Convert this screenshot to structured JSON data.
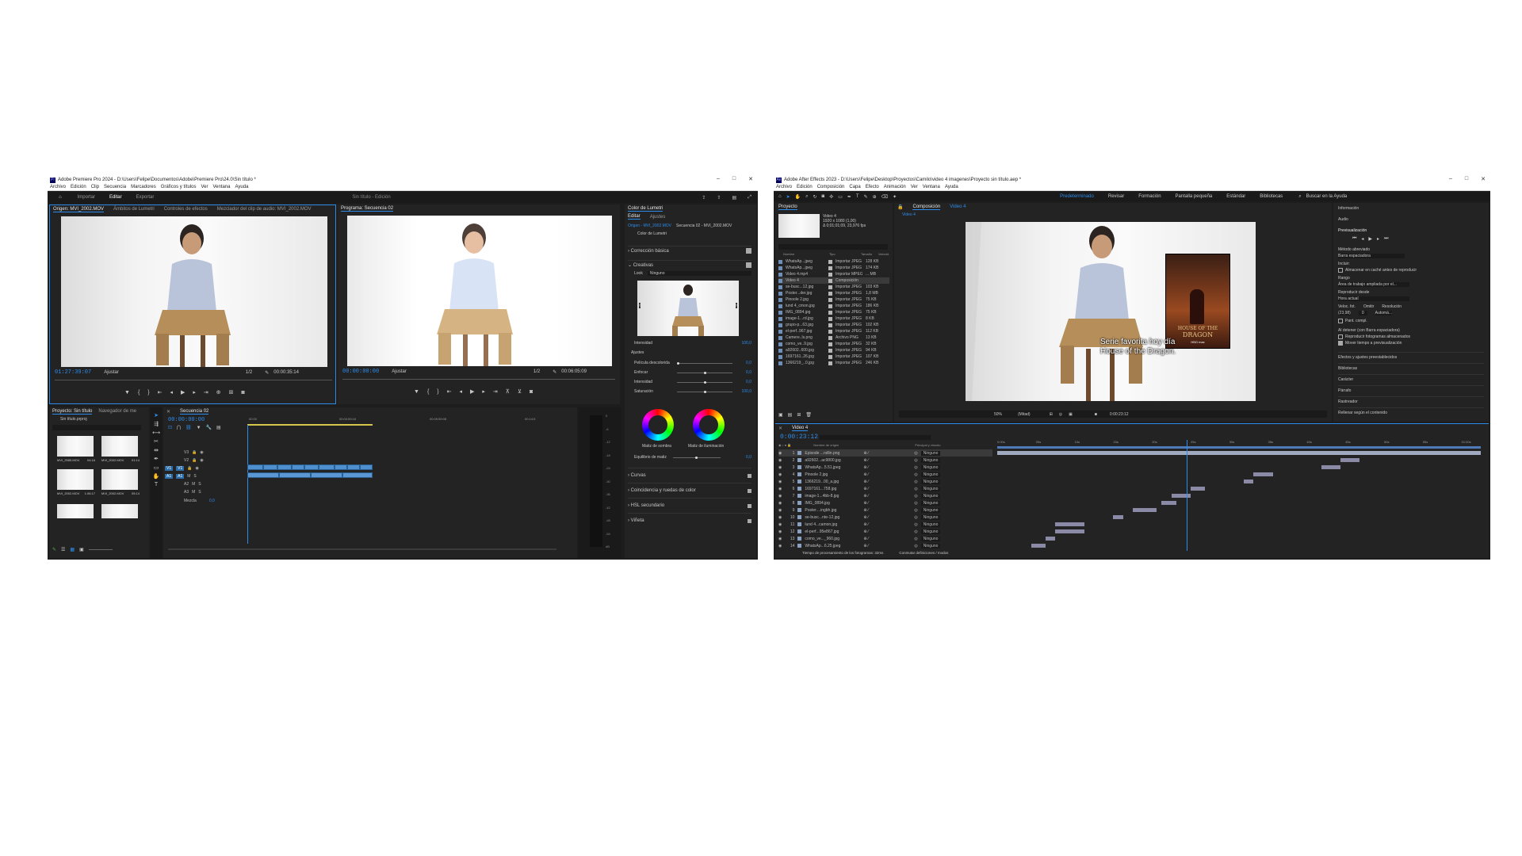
{
  "premiere": {
    "title": "Adobe Premiere Pro 2024 - D:\\Users\\Felipe\\Documentos\\Adobe\\Premiere Pro\\24.0\\Sin título *",
    "menu": [
      "Archivo",
      "Edición",
      "Clip",
      "Secuencia",
      "Marcadores",
      "Gráficos y títulos",
      "Ver",
      "Ventana",
      "Ayuda"
    ],
    "workspace_tabs": [
      "Importar",
      "Editar",
      "Exportar"
    ],
    "project_title": "Sin título - Edición",
    "source_tabs": [
      "Origen: MVI_2002.MOV",
      "Ámbitos de Lumetri",
      "Controles de efectos",
      "Mezclador del clip de audio: MVI_2002.MOV"
    ],
    "program_tab": "Programa: Secuencia 02",
    "source_tc": "01:27:39:07",
    "source_fit": "Ajustar",
    "source_ratio": "1/2",
    "source_duration": "00:00:35:14",
    "program_tc": "00:00:00:00",
    "program_fit": "Ajustar",
    "program_ratio": "1/2",
    "program_duration": "00:06:05:09",
    "lumetri": {
      "tab": "Color de Lumetri",
      "subtabs": [
        "Editar",
        "Ajustes"
      ],
      "source_clip": "Origen - MVI_2002.MOV",
      "seq_clip": "Secuencia 02 - MVI_2002.MOV",
      "effect": "Color de Lumetri",
      "sections": [
        "Corrección básica",
        "Creativas"
      ],
      "look_label": "Look",
      "look_value": "Ninguno",
      "intensity_label": "Intensidad",
      "intensity_value": "100,0",
      "adjust_label": "Ajustes",
      "sliders": [
        {
          "label": "Película descolorida",
          "value": "0,0"
        },
        {
          "label": "Enfocar",
          "value": "0,0"
        },
        {
          "label": "Intensidad",
          "value": "0,0"
        },
        {
          "label": "Saturación",
          "value": "100,0"
        }
      ],
      "wheel_labels": [
        "Matiz de sombra",
        "Matiz de iluminación"
      ],
      "balance_label": "Equilibrio de matiz",
      "balance_value": "0,0",
      "bottom_sections": [
        "Curvas",
        "Coincidencia y ruedas de color",
        "HSL secundario",
        "Viñeta"
      ]
    },
    "project_panel": {
      "tabs": [
        "Proyecto: Sin título",
        "Navegador de me"
      ],
      "file": "Sin título.prproj",
      "thumbs": [
        {
          "name": "MVI_2585.MOV",
          "dur": "04:16"
        },
        {
          "name": "MVI_2002.MOV",
          "dur": "01:14"
        },
        {
          "name": "MVI_2002.MOV",
          "dur": "1:06:17"
        },
        {
          "name": "MVI_2002.MOV",
          "dur": "05:14"
        }
      ]
    },
    "timeline": {
      "tab": "Secuencia 02",
      "tc": "00:00:00:00",
      "ruler": [
        "00:00",
        "00:04:59:16",
        "00:09:59:08",
        "00:14:5"
      ],
      "tracks": [
        "V3",
        "V2",
        "V1",
        "A1",
        "A2",
        "A3"
      ],
      "mix_label": "Mezcla",
      "mix_value": "0,0",
      "meter_labels": [
        "0",
        "-6",
        "-12",
        "-18",
        "-24",
        "-30",
        "-36",
        "-42",
        "-48",
        "-54",
        "dB"
      ]
    }
  },
  "aftereffects": {
    "title": "Adobe After Effects 2023 - D:\\Users\\Felipe\\Desktop\\Proyectos\\Camilo\\video 4 imagenes\\Proyecto sin título.aep *",
    "menu": [
      "Archivo",
      "Edición",
      "Composición",
      "Capa",
      "Efecto",
      "Animación",
      "Ver",
      "Ventana",
      "Ayuda"
    ],
    "workspaces": [
      "Predeterminado",
      "Revisar",
      "Formación",
      "Pantalla pequeña",
      "Estándar",
      "Bibliotecas"
    ],
    "search": "Buscar en la Ayuda",
    "project_tab": "Proyecto",
    "comp_info": {
      "name": "Video 4",
      "size": "1920 x 1080 (1,00)",
      "dur": "Δ 0;01;01;09, 23,976 fps"
    },
    "project_columns": [
      "Nombre",
      "Tipo",
      "Tamaño",
      "Velocid."
    ],
    "project_items": [
      {
        "name": "WhatsAp...jpeg",
        "type": "Importar JPEG",
        "size": "128 KB"
      },
      {
        "name": "WhatsAp...jpeg",
        "type": "Importar JPEG",
        "size": "174 KB"
      },
      {
        "name": "Video 4.mp4",
        "type": "Importar MPEG",
        "size": "... MB"
      },
      {
        "name": "Video 4",
        "type": "Composición",
        "size": ""
      },
      {
        "name": "se-busc...12.jpg",
        "type": "Importar JPEG",
        "size": "103 KB"
      },
      {
        "name": "Poster...der.jpg",
        "type": "Importar JPEG",
        "size": "1,8 MB"
      },
      {
        "name": "Pinoole 2.jpg",
        "type": "Importar JPEG",
        "size": "75 KB"
      },
      {
        "name": "lund 4_cmon.jpg",
        "type": "Importar JPEG",
        "size": "186 KB"
      },
      {
        "name": "IMG_0894.jpg",
        "type": "Importar JPEG",
        "size": "75 KB"
      },
      {
        "name": "image-1...rd.jpg",
        "type": "Importar JPEG",
        "size": "8 KB"
      },
      {
        "name": "grupo-p...63.jpg",
        "type": "Importar JPEG",
        "size": "102 KB"
      },
      {
        "name": "el-perf..967.jpg",
        "type": "Importar JPEG",
        "size": "112 KB"
      },
      {
        "name": "Camere..ls.png",
        "type": "Archivo PNG",
        "size": "13 KB"
      },
      {
        "name": "como_ve..9.jpg",
        "type": "Importar JPEG",
        "size": "32 KB"
      },
      {
        "name": "a92602..600.jpg",
        "type": "Importar JPEG",
        "size": "94 KB"
      },
      {
        "name": "1697161..26.jpg",
        "type": "Importar JPEG",
        "size": "107 KB"
      },
      {
        "name": "1366219_..0.jpg",
        "type": "Importar JPEG",
        "size": "246 KB"
      }
    ],
    "comp_tab": "Composición",
    "comp_name": "Video 4",
    "subtitle_line1": "Serie favorita hoy día",
    "subtitle_line2": "House of the Dragon.",
    "poster_title": "HOUSE OF THE",
    "poster_title2": "DRAGON",
    "poster_brand": "HBO max",
    "viewer_zoom": "50%",
    "viewer_res": "(Mitad)",
    "viewer_tc": "0:00:23:12",
    "right_panels": [
      "Información",
      "Audio",
      "Previsualización",
      "Efectos y ajustes preestablecidos",
      "Bibliotecas",
      "Carácter",
      "Párrafo",
      "Rastreador",
      "Rellenar según el contenido"
    ],
    "preview": {
      "shortcut_label": "Método abreviado",
      "shortcut_value": "Barra espaciadora",
      "include_label": "Incluir:",
      "cache_label": "Almacenar en caché antes de reproducir",
      "range_label": "Rango",
      "range_value": "Área de trabajo ampliada por el...",
      "play_from_label": "Reproducir desde",
      "play_from_value": "Hora actual",
      "fps_label": "Veloc. fot.",
      "fps_value": "(23,98)",
      "skip_label": "Omitir",
      "skip_value": "0",
      "res_label": "Resolución",
      "res_value": "Automá...",
      "fullscreen": "Pant. compl.",
      "stop_label": "Al detener (con Barra espaciadora)",
      "opt1": "Reproducir fotogramas almacenados",
      "opt2": "Mover tiempo a previsualización"
    },
    "timeline": {
      "tab": "Video 4",
      "tc": "0:00:23:12",
      "col_source": "Nombre de origen",
      "col_parent": "Principal y vínculo",
      "ruler": [
        "0:00s",
        "05s",
        "10s",
        "15s",
        "20s",
        "25s",
        "30s",
        "35s",
        "40s",
        "45s",
        "50s",
        "55s",
        "01:00s"
      ],
      "layers": [
        {
          "n": "1",
          "name": "Episode ...ndlin.png",
          "parent": "Ninguno"
        },
        {
          "n": "2",
          "name": "a92602...ac9800.jpg",
          "parent": "Ninguno"
        },
        {
          "n": "3",
          "name": "WhatsAp...5.51.jpeg",
          "parent": "Ninguno"
        },
        {
          "n": "4",
          "name": "Pinoole 2.jpg",
          "parent": "Ninguno"
        },
        {
          "n": "5",
          "name": "1366219...00_a.jpg",
          "parent": "Ninguno"
        },
        {
          "n": "6",
          "name": "1697161...758.jpg",
          "parent": "Ninguno"
        },
        {
          "n": "7",
          "name": "image-1...4bb-8.jpg",
          "parent": "Ninguno"
        },
        {
          "n": "8",
          "name": "IMG_0894.jpg",
          "parent": "Ninguno"
        },
        {
          "n": "9",
          "name": "Poster....ingbh.jpg",
          "parent": "Ninguno"
        },
        {
          "n": "10",
          "name": "se-busc...nte-12.jpg",
          "parent": "Ninguno"
        },
        {
          "n": "11",
          "name": "lund 4...camon.jpg",
          "parent": "Ninguno"
        },
        {
          "n": "12",
          "name": "el-perf...95e867.jpg",
          "parent": "Ninguno"
        },
        {
          "n": "13",
          "name": "como_ve..._960.jpg",
          "parent": "Ninguno"
        },
        {
          "n": "14",
          "name": "WhatsAp...6.25.jpeg",
          "parent": "Ninguno"
        }
      ],
      "status_left": "Tiempo de procesamiento de los fotogramas: 32ms",
      "status_mid": "Conmutar definiciones / modos"
    }
  }
}
